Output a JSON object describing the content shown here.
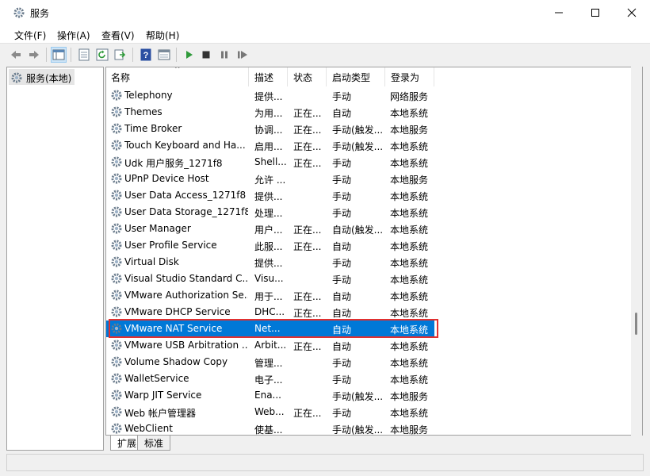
{
  "window": {
    "title": "服务"
  },
  "menu": [
    "文件(F)",
    "操作(A)",
    "查看(V)",
    "帮助(H)"
  ],
  "tree": {
    "root_label": "服务(本地)"
  },
  "columns": [
    "名称",
    "描述",
    "状态",
    "启动类型",
    "登录为"
  ],
  "services": [
    {
      "name": "Telephony",
      "desc": "提供...",
      "status": "",
      "startup": "手动",
      "logon": "网络服务"
    },
    {
      "name": "Themes",
      "desc": "为用...",
      "status": "正在...",
      "startup": "自动",
      "logon": "本地系统"
    },
    {
      "name": "Time Broker",
      "desc": "协调...",
      "status": "正在...",
      "startup": "手动(触发...",
      "logon": "本地服务"
    },
    {
      "name": "Touch Keyboard and Ha...",
      "desc": "启用...",
      "status": "正在...",
      "startup": "手动(触发...",
      "logon": "本地系统"
    },
    {
      "name": "Udk 用户服务_1271f8",
      "desc": "Shell...",
      "status": "正在...",
      "startup": "手动",
      "logon": "本地系统"
    },
    {
      "name": "UPnP Device Host",
      "desc": "允许 ...",
      "status": "",
      "startup": "手动",
      "logon": "本地服务"
    },
    {
      "name": "User Data Access_1271f8",
      "desc": "提供...",
      "status": "",
      "startup": "手动",
      "logon": "本地系统"
    },
    {
      "name": "User Data Storage_1271f8",
      "desc": "处理...",
      "status": "",
      "startup": "手动",
      "logon": "本地系统"
    },
    {
      "name": "User Manager",
      "desc": "用户...",
      "status": "正在...",
      "startup": "自动(触发...",
      "logon": "本地系统"
    },
    {
      "name": "User Profile Service",
      "desc": "此服...",
      "status": "正在...",
      "startup": "自动",
      "logon": "本地系统"
    },
    {
      "name": "Virtual Disk",
      "desc": "提供...",
      "status": "",
      "startup": "手动",
      "logon": "本地系统"
    },
    {
      "name": "Visual Studio Standard C...",
      "desc": "Visu...",
      "status": "",
      "startup": "手动",
      "logon": "本地系统"
    },
    {
      "name": "VMware Authorization Se...",
      "desc": "用于...",
      "status": "正在...",
      "startup": "自动",
      "logon": "本地系统"
    },
    {
      "name": "VMware DHCP Service",
      "desc": "DHC...",
      "status": "正在...",
      "startup": "自动",
      "logon": "本地系统"
    },
    {
      "name": "VMware NAT Service",
      "desc": "Net...",
      "status": "",
      "startup": "自动",
      "logon": "本地系统"
    },
    {
      "name": "VMware USB Arbitration ...",
      "desc": "Arbit...",
      "status": "正在...",
      "startup": "自动",
      "logon": "本地系统"
    },
    {
      "name": "Volume Shadow Copy",
      "desc": "管理...",
      "status": "",
      "startup": "手动",
      "logon": "本地系统"
    },
    {
      "name": "WalletService",
      "desc": "电子...",
      "status": "",
      "startup": "手动",
      "logon": "本地系统"
    },
    {
      "name": "Warp JIT Service",
      "desc": "Ena...",
      "status": "",
      "startup": "手动(触发...",
      "logon": "本地服务"
    },
    {
      "name": "Web 帐户管理器",
      "desc": "Web...",
      "status": "正在...",
      "startup": "手动",
      "logon": "本地系统"
    },
    {
      "name": "WebClient",
      "desc": "使基...",
      "status": "",
      "startup": "手动(触发...",
      "logon": "本地服务"
    }
  ],
  "selected_index": 14,
  "tabs": [
    "扩展",
    "标准"
  ],
  "colors": {
    "selection": "#0078d7",
    "highlight_border": "#e03030"
  }
}
